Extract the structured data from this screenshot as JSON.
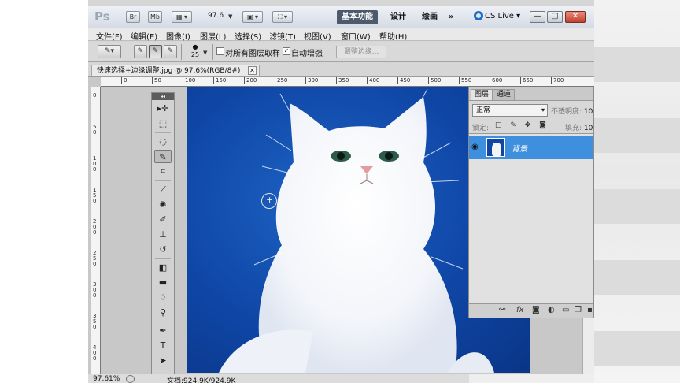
{
  "app": {
    "logo": "Ps",
    "bridge_btn": "Br",
    "mini_btn": "Mb",
    "zoom_value": "97.6",
    "workspaces": [
      "基本功能",
      "设计",
      "绘画"
    ],
    "more": "»",
    "cs_live": "CS Live",
    "window_controls": [
      "—",
      "▢",
      "✕"
    ]
  },
  "menu": [
    "文件(F)",
    "编辑(E)",
    "图像(I)",
    "图层(L)",
    "选择(S)",
    "滤镜(T)",
    "视图(V)",
    "窗口(W)",
    "帮助(H)"
  ],
  "options": {
    "brush_size": "25",
    "sample_all_layers_label": "对所有图层取样",
    "sample_all_layers_checked": false,
    "auto_enhance_label": "自动增强",
    "auto_enhance_checked": true,
    "refine_edge_label": "调整边缘..."
  },
  "document": {
    "tab_title": "快速选择+边缘调整.jpg @ 97.6%(RGB/8#)",
    "close": "✕",
    "status_zoom": "97.61%",
    "status_doc": "文档:924.9K/924.9K",
    "canvas_bg": "#0f46a6"
  },
  "rulers": {
    "h_labels": [
      "0",
      "50",
      "100",
      "150",
      "200",
      "250",
      "300",
      "350",
      "400",
      "450",
      "500",
      "550",
      "600",
      "650",
      "700"
    ],
    "v_labels": [
      "0",
      "50",
      "100",
      "150",
      "200",
      "250",
      "300",
      "350",
      "400",
      "450"
    ]
  },
  "toolbox": {
    "header": "◂◂",
    "tools": [
      "move-tool",
      "marquee-tool",
      "lasso-tool",
      "quick-selection-tool",
      "crop-tool",
      "eyedropper-tool",
      "spot-heal-tool",
      "brush-tool",
      "clone-stamp-tool",
      "history-brush-tool",
      "eraser-tool",
      "gradient-tool",
      "blur-tool",
      "dodge-tool",
      "pen-tool",
      "type-tool",
      "path-select-tool",
      "shape-tool"
    ]
  },
  "layers_panel": {
    "tabs": [
      "图层",
      "通道"
    ],
    "blend_mode": "正常",
    "opacity_label": "不透明度:",
    "opacity_value": "10",
    "lock_label": "锁定:",
    "fill_label": "填充:",
    "fill_value": "10",
    "layers": [
      {
        "name": "背景",
        "visible": true
      }
    ],
    "accent": "#3f8fdf"
  }
}
